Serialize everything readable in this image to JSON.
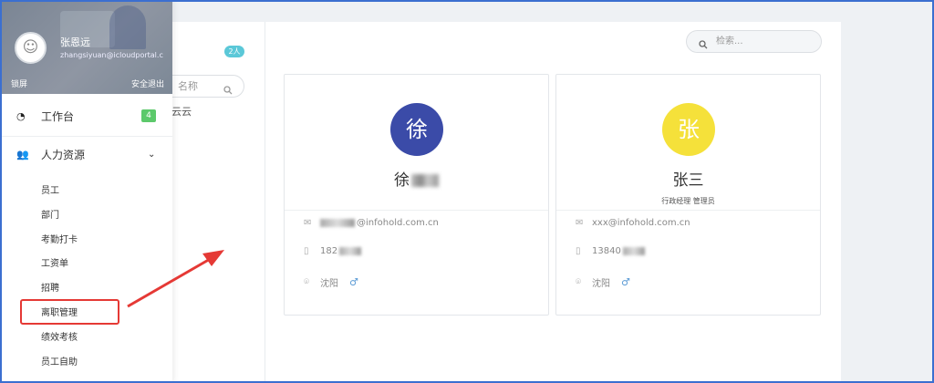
{
  "user": {
    "name": "张恩远",
    "email": "zhangsiyuan@icloudportal.c",
    "lock": "锁屏",
    "logout": "安全退出"
  },
  "menu": {
    "workbench": {
      "label": "工作台",
      "badge": "4"
    },
    "hr": {
      "label": "人力资源"
    },
    "sub_items": [
      "员工",
      "部门",
      "考勤打卡",
      "工资单",
      "招聘",
      "离职管理",
      "绩效考核",
      "员工自助"
    ]
  },
  "group": {
    "badge": "2人",
    "search_placeholder": "名称",
    "item": "云云"
  },
  "search": {
    "placeholder": "检索..."
  },
  "employees": [
    {
      "avatar": "徐",
      "avatar_color": "#3b4ba8",
      "name": "徐",
      "role": "",
      "email": "@infohold.com.cn",
      "phone": "182",
      "city": "沈阳"
    },
    {
      "avatar": "张",
      "avatar_color": "#f5e13a",
      "name": "张三",
      "role": "行政经理 管理员",
      "email": "xxx@infohold.com.cn",
      "phone": "13840",
      "city": "沈阳"
    }
  ],
  "icons": {
    "workbench": "dashboard-icon",
    "hr": "people-icon",
    "search": "search-icon",
    "email": "mail-icon",
    "phone": "phone-icon",
    "location": "location-pin-icon",
    "gender": "male-icon"
  },
  "colors": {
    "accent": "#5bc8d8",
    "badge_green": "#5cc96b",
    "highlight": "#e53935"
  }
}
